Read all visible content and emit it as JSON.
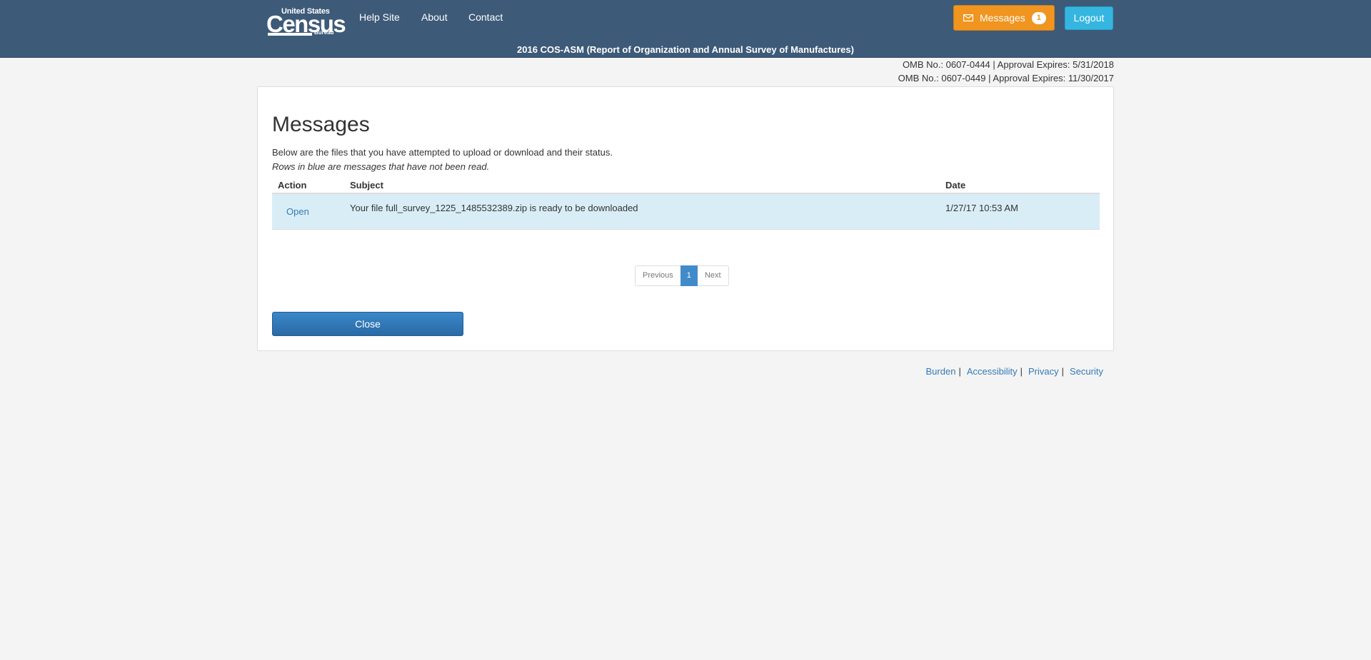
{
  "header": {
    "logo": {
      "top_text": "United States",
      "main_text": "Census",
      "bottom_text": "Bureau"
    },
    "nav": {
      "help_site": "Help Site",
      "about": "About",
      "contact": "Contact"
    },
    "messages_button": {
      "label": "Messages",
      "count": "1",
      "icon": "envelope-icon"
    },
    "logout_label": "Logout",
    "survey_title": "2016 COS-ASM (Report of Organization and Annual Survey of Manufactures)"
  },
  "omb": [
    "OMB No.: 0607-0444  |  Approval Expires: 5/31/2018",
    "OMB No.: 0607-0449  |  Approval Expires: 11/30/2017"
  ],
  "main": {
    "title": "Messages",
    "intro": "Below are the files that you have attempted to upload or download and their status.",
    "note": "Rows in blue are messages that have not been read.",
    "table": {
      "headers": {
        "action": "Action",
        "subject": "Subject",
        "date": "Date"
      },
      "rows": [
        {
          "action": "Open",
          "subject": "Your file full_survey_1225_1485532389.zip is ready to be downloaded",
          "date": "1/27/17 10:53 AM",
          "unread": true
        }
      ]
    },
    "pagination": {
      "previous": "Previous",
      "current": "1",
      "next": "Next"
    },
    "close_label": "Close"
  },
  "footer": {
    "links": [
      "Burden",
      "Accessibility",
      "Privacy",
      "Security"
    ],
    "separator": "|"
  },
  "colors": {
    "navbar": "#3d5a78",
    "messages_button": "#f0951f",
    "logout_button": "#35b6e0",
    "unread_row": "#d9edf7",
    "link": "#337ab7",
    "primary_button": "#2a6aa6"
  }
}
